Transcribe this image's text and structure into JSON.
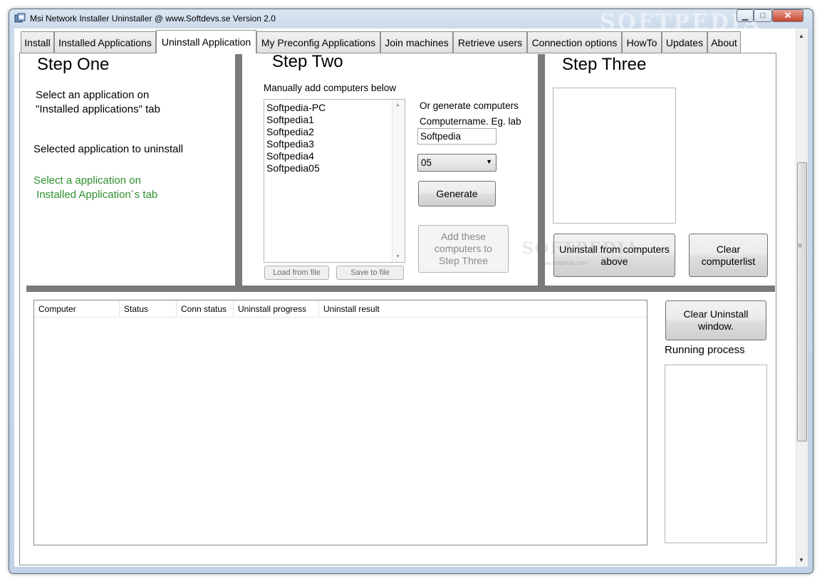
{
  "window": {
    "title": "Msi Network Installer Uninstaller @ www.Softdevs.se  Version 2.0",
    "watermark": "SOFTPEDIA",
    "minimize_glyph": "▁",
    "maximize_glyph": "□",
    "close_glyph": "✕"
  },
  "tabs": [
    {
      "label": "Install"
    },
    {
      "label": "Installed Applications"
    },
    {
      "label": "Uninstall Application",
      "active": true
    },
    {
      "label": "My Preconfig Applications"
    },
    {
      "label": "Join machines"
    },
    {
      "label": "Retrieve users"
    },
    {
      "label": "Connection options"
    },
    {
      "label": "HowTo"
    },
    {
      "label": "Updates"
    },
    {
      "label": "About"
    }
  ],
  "step_one": {
    "heading": "Step One",
    "instruction_line1": "Select an application on",
    "instruction_line2": "\"Installed applications\" tab",
    "selected_label": "Selected application to uninstall",
    "selected_value_line1": "Select a application on",
    "selected_value_line2": " Installed Application´s tab"
  },
  "step_two": {
    "heading": "Step Two",
    "manual_label": "Manually add computers below",
    "computers": [
      "Softpedia-PC",
      "Softpedia1",
      "Softpedia2",
      "Softpedia3",
      "Softpedia4",
      "Softpedia05"
    ],
    "load_button": "Load from file",
    "save_button": "Save to file",
    "generate_label": "Or generate computers",
    "computername_label": "Computername. Eg. lab",
    "computername_value": "Softpedia",
    "count_selected": "05",
    "generate_button": "Generate",
    "add_button_line1": "Add these",
    "add_button_line2": "computers to",
    "add_button_line3": "Step Three"
  },
  "step_three": {
    "heading": "Step Three",
    "uninstall_button_line1": "Uninstall from computers",
    "uninstall_button_line2": "above",
    "clear_button_line1": "Clear",
    "clear_button_line2": "computerlist",
    "watermark_small": "www.softpedia.com"
  },
  "grid": {
    "columns": [
      "Computer",
      "Status",
      "Conn status",
      "Uninstall progress",
      "Uninstall result"
    ]
  },
  "right_panel": {
    "clear_button_line1": "Clear Uninstall",
    "clear_button_line2": "window.",
    "running_label": "Running process"
  },
  "colors": {
    "divider": "#7a7a7a",
    "green_text": "#2f8f2f"
  }
}
